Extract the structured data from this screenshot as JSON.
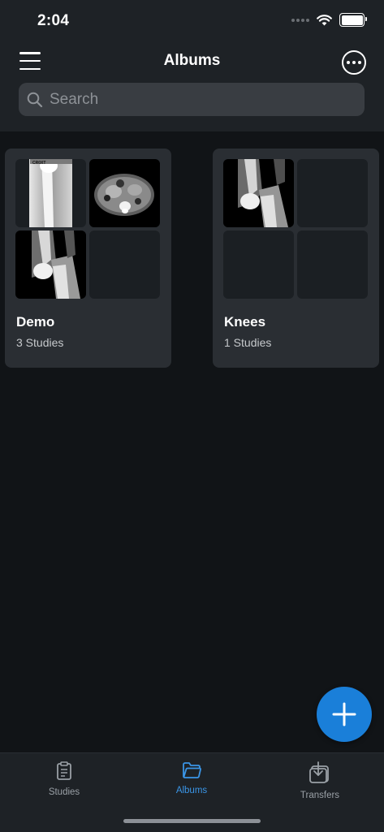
{
  "status_bar": {
    "time": "2:04"
  },
  "header": {
    "title": "Albums"
  },
  "search": {
    "placeholder": "Search"
  },
  "albums": [
    {
      "name": "Demo",
      "count": "3 Studies"
    },
    {
      "name": "Knees",
      "count": "1 Studies"
    }
  ],
  "thumb_labels": {
    "xray_tag": "CR0XT"
  },
  "tabs": [
    {
      "label": "Studies",
      "icon": "clipboard-icon",
      "active": false
    },
    {
      "label": "Albums",
      "icon": "folder-icon",
      "active": true
    },
    {
      "label": "Transfers",
      "icon": "download-tray-icon",
      "active": false
    }
  ],
  "colors": {
    "accent": "#1a7fd9",
    "active_tab": "#3a95e6",
    "background": "#111417",
    "card": "#2a2e33"
  }
}
